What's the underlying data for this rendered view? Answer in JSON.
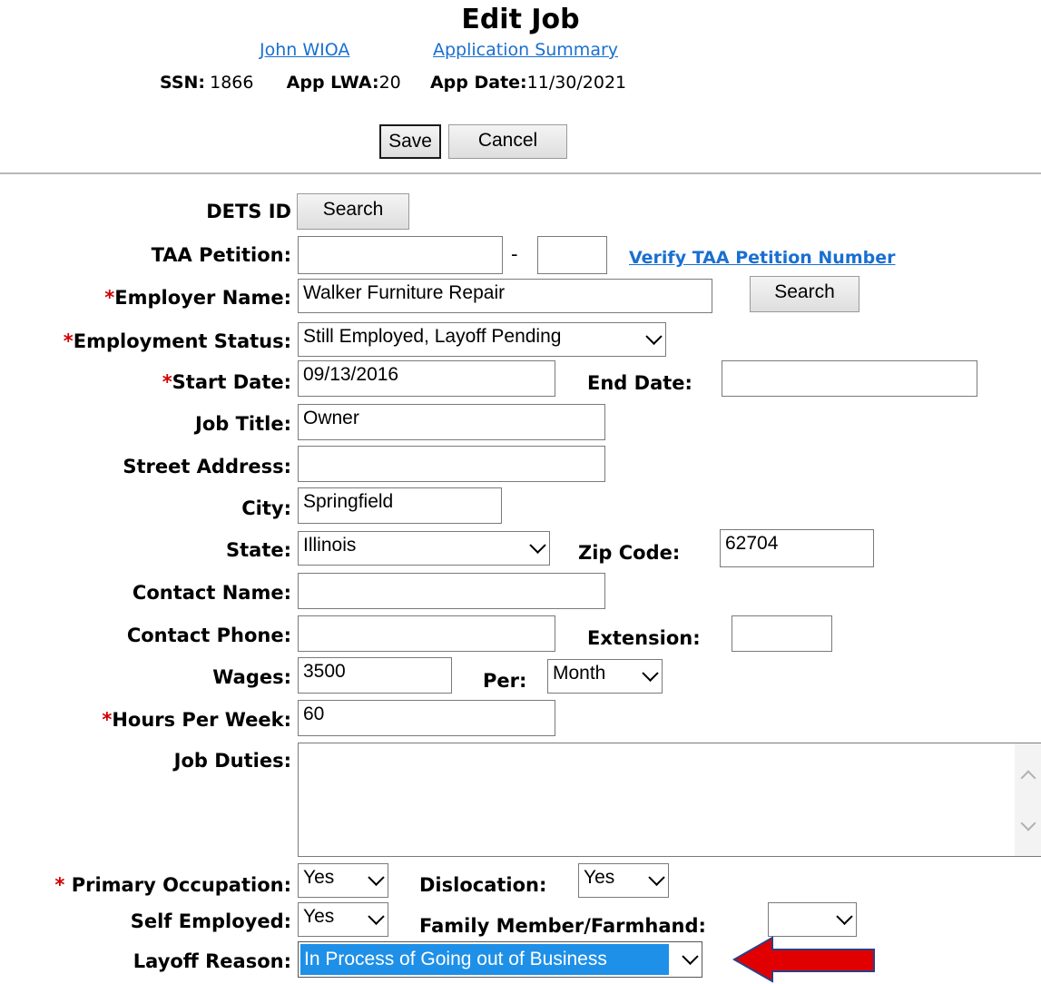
{
  "page_title": "Edit Job",
  "header_links": {
    "applicant_name": "John WIOA",
    "app_summary": "Application Summary"
  },
  "summary": {
    "ssn_label": "SSN:",
    "ssn_value": "1866",
    "lwa_label": "App LWA:",
    "lwa_value": "20",
    "date_label": "App Date:",
    "date_value": "11/30/2021"
  },
  "actions": {
    "save": "Save",
    "cancel": "Cancel"
  },
  "form": {
    "dets_id": {
      "label": "DETS ID",
      "button": "Search"
    },
    "taa_petition": {
      "label": "TAA Petition:",
      "value1": "",
      "separator": "-",
      "value2": "",
      "verify_link": "Verify TAA Petition Number"
    },
    "employer_name": {
      "required": "*",
      "label": "Employer Name:",
      "value": "Walker Furniture Repair",
      "button": "Search"
    },
    "employment_status": {
      "required": "*",
      "label": "Employment Status:",
      "value": "Still Employed, Layoff Pending"
    },
    "start_date": {
      "required": "*",
      "label": "Start Date:",
      "value": "09/13/2016"
    },
    "end_date": {
      "label": "End Date:",
      "value": ""
    },
    "job_title": {
      "label": "Job Title:",
      "value": "Owner"
    },
    "street_address": {
      "label": "Street Address:",
      "value": ""
    },
    "city": {
      "label": "City:",
      "value": "Springfield"
    },
    "state": {
      "label": "State:",
      "value": "Illinois"
    },
    "zip_code": {
      "label": "Zip Code:",
      "value": "62704"
    },
    "contact_name": {
      "label": "Contact Name:",
      "value": ""
    },
    "contact_phone": {
      "label": "Contact Phone:",
      "value": ""
    },
    "extension": {
      "label": "Extension:",
      "value": ""
    },
    "wages": {
      "label": "Wages:",
      "value": "3500"
    },
    "per": {
      "label": "Per:",
      "value": "Month"
    },
    "hours_per_week": {
      "required": "*",
      "label": "Hours Per Week:",
      "value": "60"
    },
    "job_duties": {
      "label": "Job Duties:",
      "value": ""
    },
    "primary_occupation": {
      "required": "*",
      "label": " Primary Occupation:",
      "value": "Yes"
    },
    "dislocation": {
      "label": "Dislocation:",
      "value": "Yes"
    },
    "self_employed": {
      "label": "Self Employed:",
      "value": "Yes"
    },
    "family_member": {
      "label": "Family Member/Farmhand:",
      "value": ""
    },
    "layoff_reason": {
      "label": "Layoff Reason:",
      "value": "In Process of Going out of Business"
    }
  },
  "colors": {
    "link": "#1a6fd1",
    "required": "#d00000",
    "selection": "#1e90e8",
    "arrow": "#e10000"
  }
}
